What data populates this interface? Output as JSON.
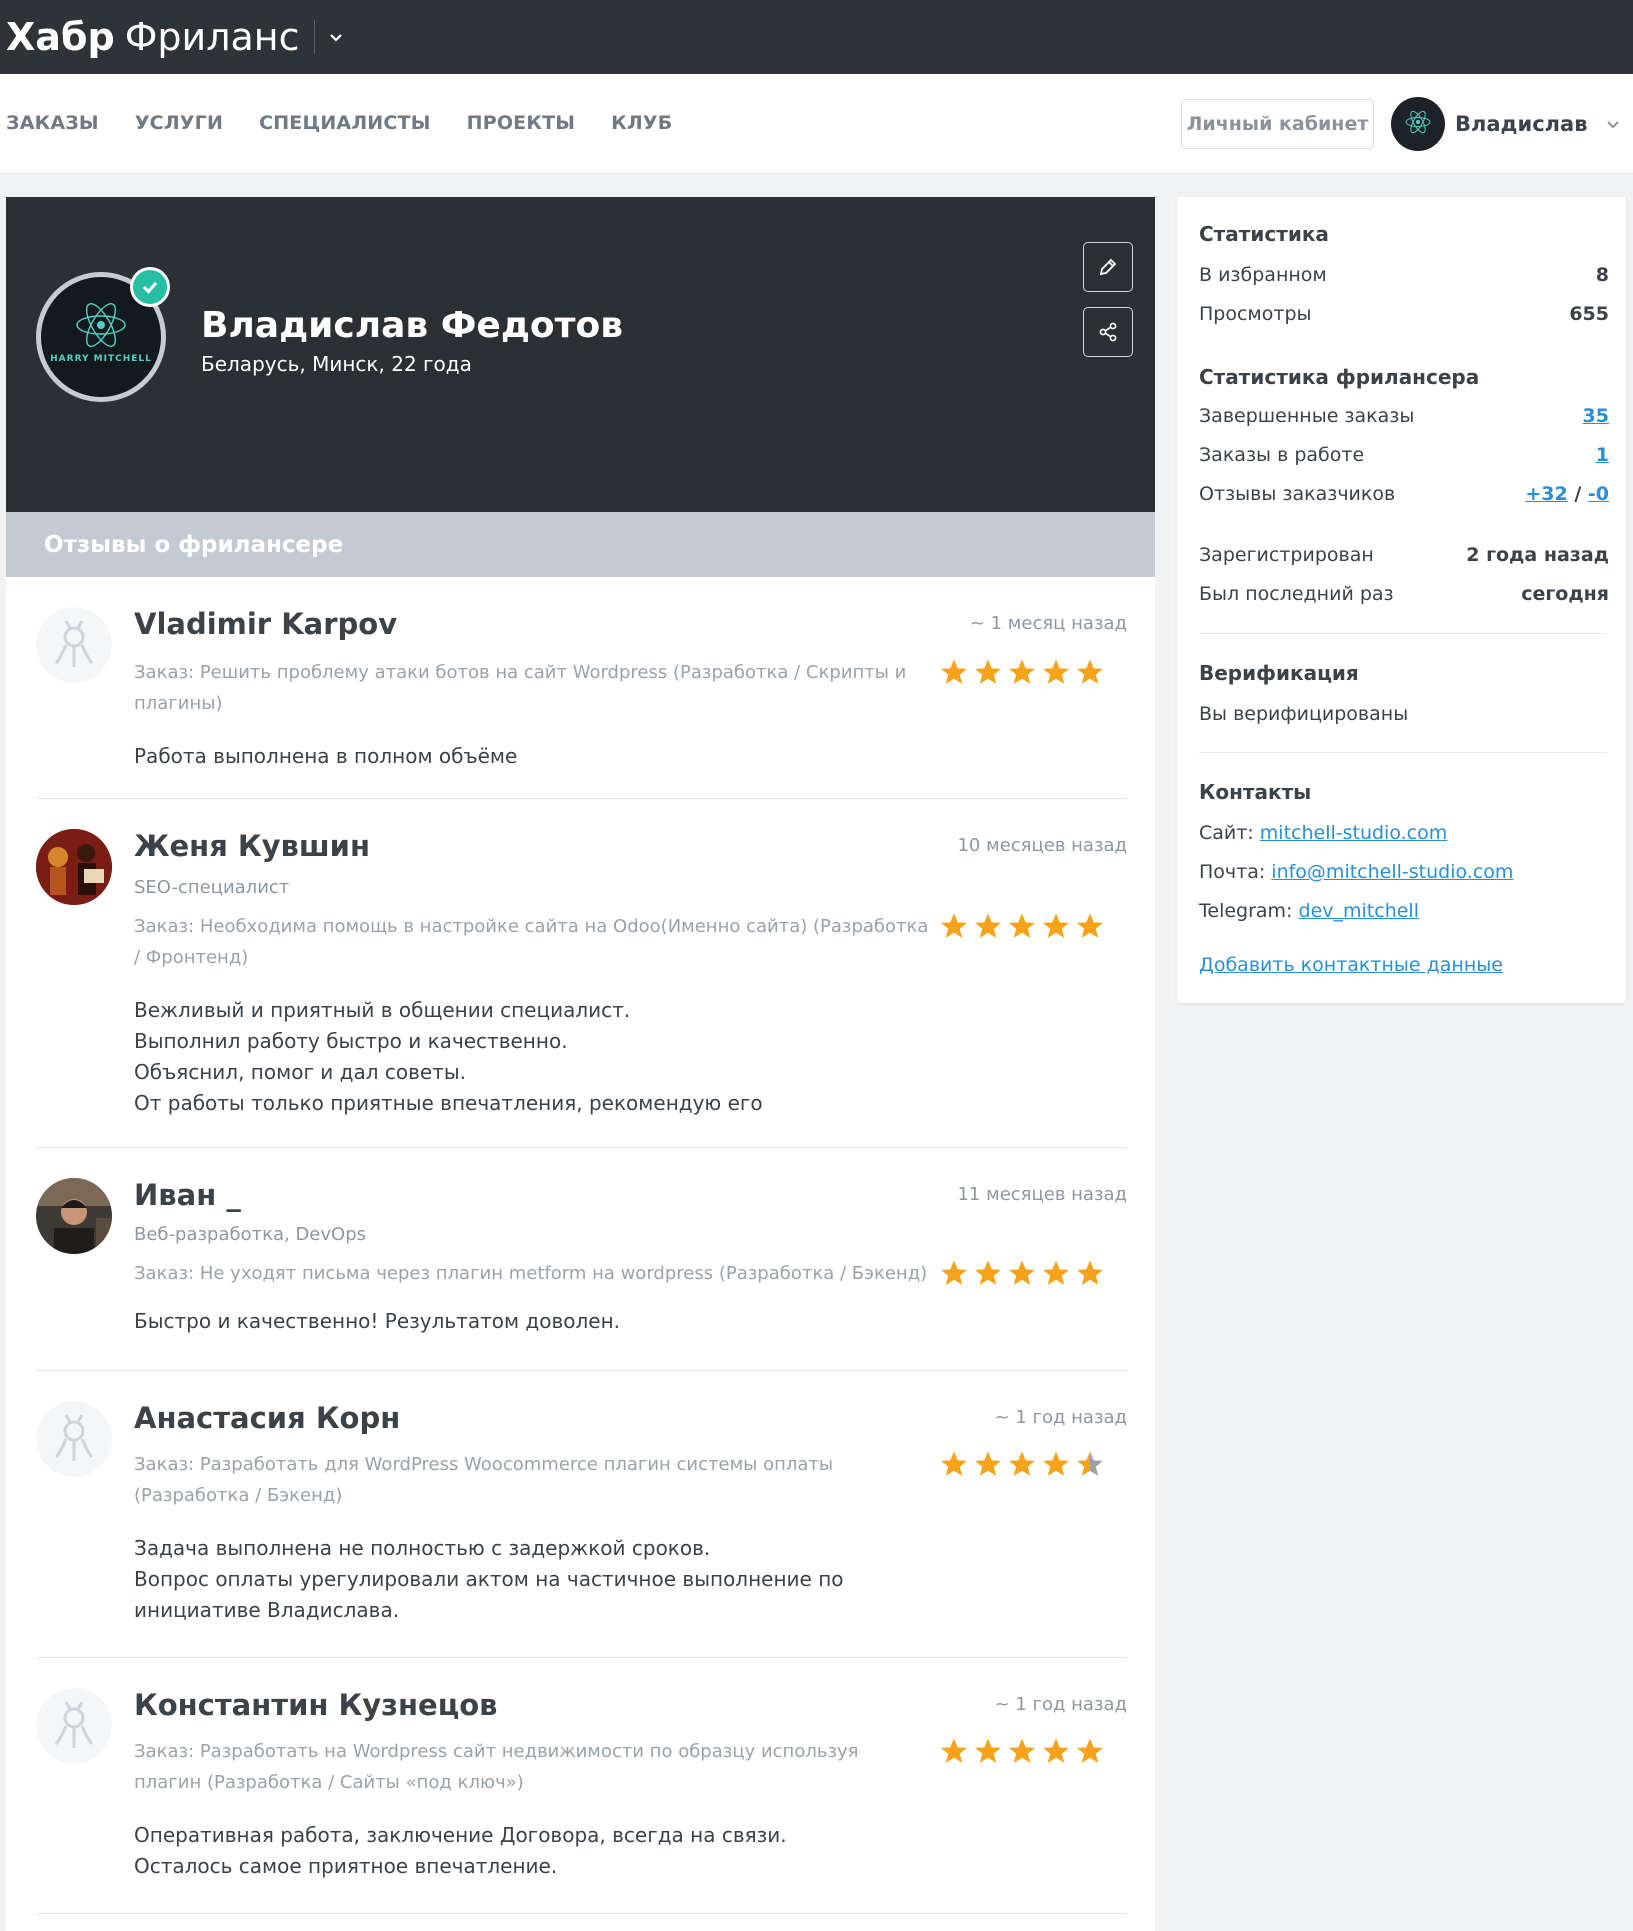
{
  "logo": {
    "brand": "Хабр",
    "product": "Фриланс"
  },
  "nav": {
    "items": [
      "ЗАКАЗЫ",
      "УСЛУГИ",
      "СПЕЦИАЛИСТЫ",
      "ПРОЕКТЫ",
      "КЛУБ"
    ],
    "cabinet": "Личный кабинет",
    "user": "Владислав"
  },
  "profile": {
    "name": "Владислав Федотов",
    "location": "Беларусь, Минск, 22 года",
    "avatar_text": "HARRY MITCHELL"
  },
  "reviews": {
    "title": "Отзывы о фрилансере",
    "items": [
      {
        "name": "Vladimir Karpov",
        "time": "~ 1 месяц назад",
        "spec": "",
        "order": "Заказ: Решить проблему атаки ботов на сайт Wordpress (Разработка / Скрипты и плагины)",
        "text": "Работа выполнена в полном объёме",
        "rating": 5
      },
      {
        "name": "Женя Кувшин",
        "time": "10 месяцев назад",
        "spec": "SEO-специалист",
        "order": "Заказ: Необходима помощь в настройке сайта на Odoo(Именно сайта) (Разработка / Фронтенд)",
        "text": "Вежливый и приятный в общении специалист.\nВыполнил работу быстро и качественно.\nОбъяснил, помог и дал советы.\nОт работы только приятные впечатления, рекомендую его",
        "rating": 5
      },
      {
        "name": "Иван _",
        "time": "11 месяцев назад",
        "spec": "Веб-разработка, DevOps",
        "order": "Заказ: Не уходят письма через плагин metform на wordpress (Разработка / Бэкенд)",
        "text": "Быстро и качественно! Результатом доволен.",
        "rating": 5
      },
      {
        "name": "Анастасия Корн",
        "time": "~ 1 год назад",
        "spec": "",
        "order": "Заказ: Разработать для WordPress Woocommerce плагин системы оплаты (Разработка / Бэкенд)",
        "text": "Задача выполнена не полностью с задержкой сроков.\nВопрос оплаты урегулировали актом на частичное выполнение по инициативе Владислава.",
        "rating": 4.5
      },
      {
        "name": "Константин Кузнецов",
        "time": "~ 1 год назад",
        "spec": "",
        "order": "Заказ: Разработать на Wordpress сайт недвижимости по образцу используя плагин (Разработка / Сайты «под ключ»)",
        "text": "Оперативная работа, заключение Договора, всегда на связи.\nОсталось самое приятное впечатление.",
        "rating": 5
      }
    ]
  },
  "stats": {
    "title": "Статистика",
    "favorites_label": "В избранном",
    "favorites": "8",
    "views_label": "Просмотры",
    "views": "655"
  },
  "freelancer_stats": {
    "title": "Статистика фрилансера",
    "completed_label": "Завершенные заказы",
    "completed": "35",
    "in_work_label": "Заказы в работе",
    "in_work": "1",
    "reviews_label": "Отзывы заказчиков",
    "reviews_pos": "+32",
    "reviews_sep": "/",
    "reviews_neg": "-0",
    "registered_label": "Зарегистрирован",
    "registered": "2 года назад",
    "last_seen_label": "Был последний раз",
    "last_seen": "сегодня"
  },
  "verification": {
    "title": "Верификация",
    "text": "Вы верифицированы"
  },
  "contacts": {
    "title": "Контакты",
    "site_label": "Сайт:",
    "site": "mitchell-studio.com",
    "mail_label": "Почта:",
    "mail": "info@mitchell-studio.com",
    "tg_label": "Telegram:",
    "tg": "dev_mitchell",
    "add": "Добавить контактные данные"
  },
  "colors": {
    "topbar": "#2e3338",
    "hero": "#2b3035",
    "link": "#2a8fd6",
    "star": "#f7a21b",
    "verified": "#26bfa6",
    "reviews_header": "#c4cad3"
  },
  "icons": [
    "chevron-down-icon",
    "edit-icon",
    "share-icon",
    "check-icon",
    "star-icon"
  ]
}
